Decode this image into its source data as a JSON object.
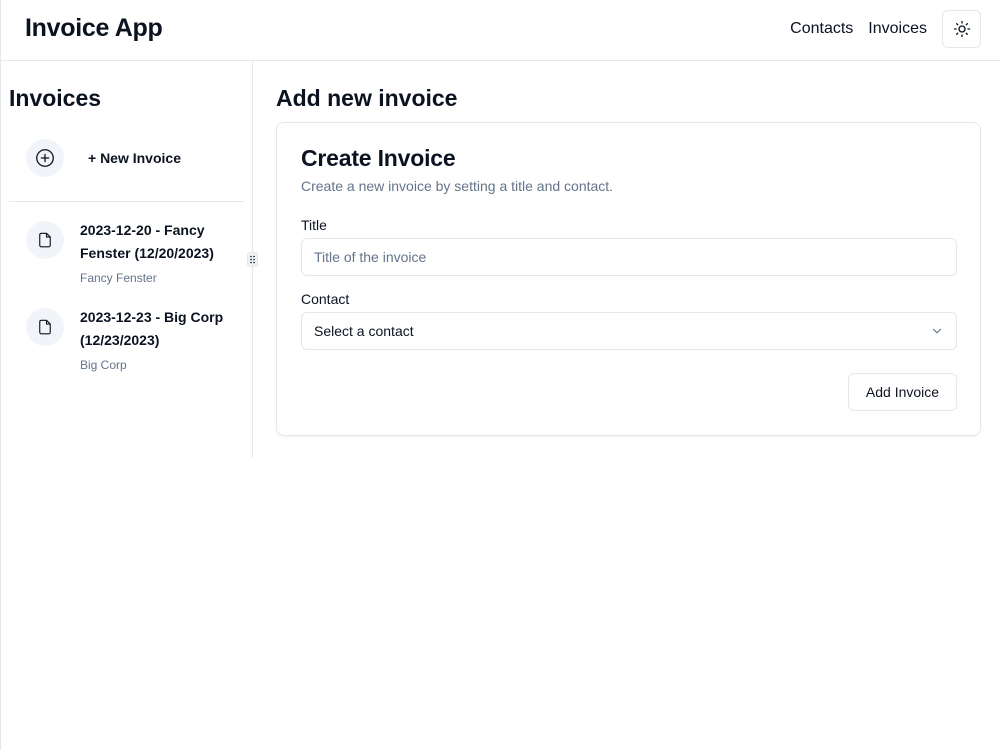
{
  "header": {
    "app_title": "Invoice App",
    "nav": [
      {
        "label": "Contacts"
      },
      {
        "label": "Invoices"
      }
    ],
    "theme_toggle_icon": "sun-icon"
  },
  "sidebar": {
    "heading": "Invoices",
    "new_invoice": {
      "label": "+ New Invoice",
      "icon": "plus-circle-icon"
    },
    "invoices": [
      {
        "title": "2023-12-20 - Fancy Fenster (12/20/2023)",
        "contact": "Fancy Fenster",
        "icon": "file-icon"
      },
      {
        "title": "2023-12-23 - Big Corp (12/23/2023)",
        "contact": "Big Corp",
        "icon": "file-icon"
      }
    ]
  },
  "main": {
    "heading": "Add new invoice",
    "card": {
      "title": "Create Invoice",
      "description": "Create a new invoice by setting a title and contact.",
      "title_field": {
        "label": "Title",
        "placeholder": "Title of the invoice",
        "value": ""
      },
      "contact_field": {
        "label": "Contact",
        "value": "Select a contact"
      },
      "submit_label": "Add Invoice"
    }
  },
  "colors": {
    "text": "#0b1220",
    "muted": "#64748b",
    "border": "#e5e7eb",
    "icon_bg": "#f1f4f9"
  }
}
